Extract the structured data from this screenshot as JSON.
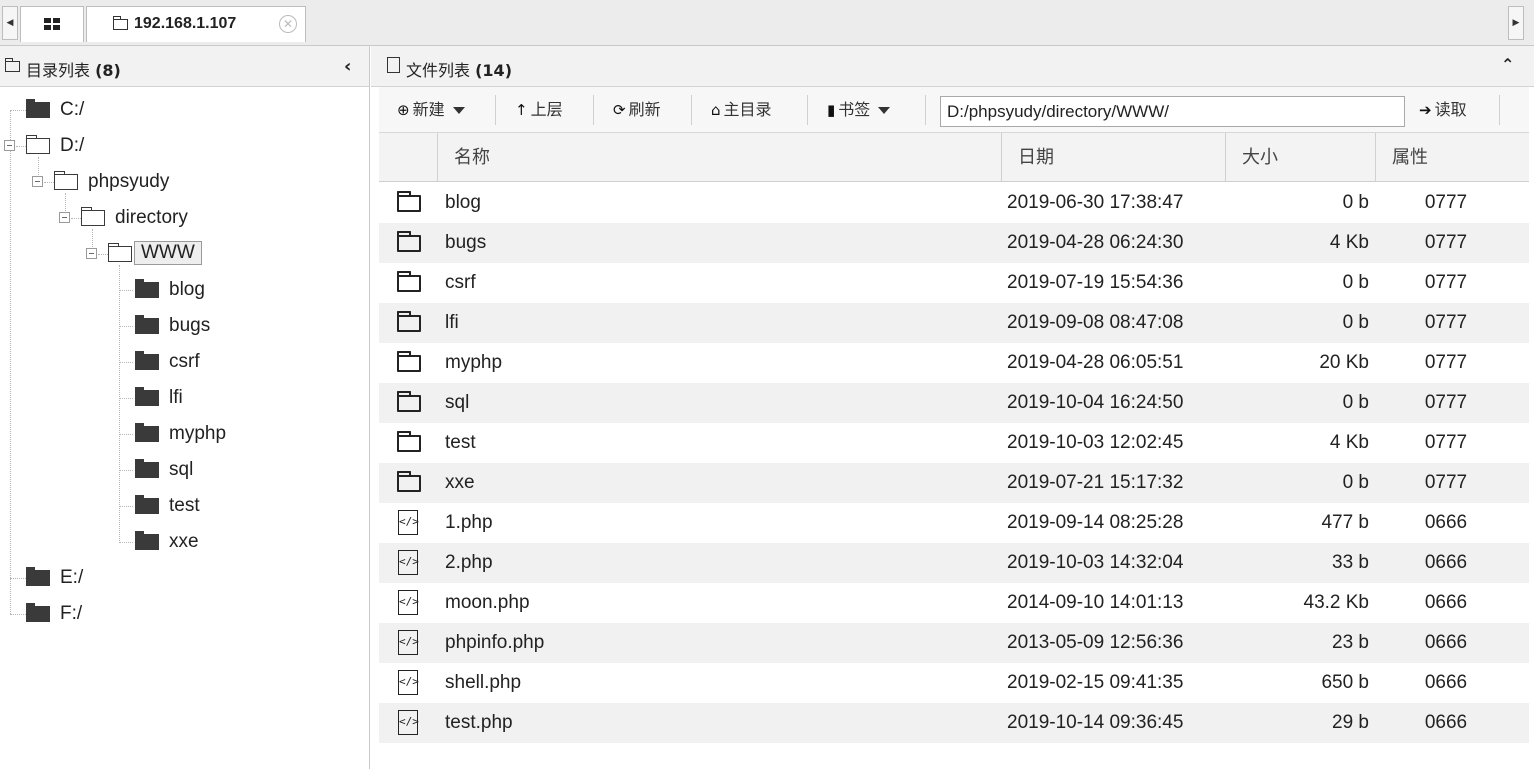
{
  "tabs": {
    "active_title": "192.168.1.107"
  },
  "left": {
    "title": "目录列表",
    "count": "(8)",
    "tree": {
      "c_drive": "C:/",
      "d_drive": "D:/",
      "phpsyudy": "phpsyudy",
      "directory": "directory",
      "www": "WWW",
      "children": [
        "blog",
        "bugs",
        "csrf",
        "lfi",
        "myphp",
        "sql",
        "test",
        "xxe"
      ],
      "e_drive": "E:/",
      "f_drive": "F:/"
    }
  },
  "right": {
    "title": "文件列表",
    "count": "(14)",
    "toolbar": {
      "new_label": "新建",
      "up_label": "上层",
      "refresh_label": "刷新",
      "home_label": "主目录",
      "bookmark_label": "书签",
      "path_value": "D:/phpsyudy/directory/WWW/",
      "read_label": "读取"
    },
    "columns": {
      "name": "名称",
      "date": "日期",
      "size": "大小",
      "attr": "属性"
    },
    "files": [
      {
        "type": "folder",
        "name": "blog",
        "date": "2019-06-30 17:38:47",
        "size": "0 b",
        "attr": "0777"
      },
      {
        "type": "folder",
        "name": "bugs",
        "date": "2019-04-28 06:24:30",
        "size": "4 Kb",
        "attr": "0777"
      },
      {
        "type": "folder",
        "name": "csrf",
        "date": "2019-07-19 15:54:36",
        "size": "0 b",
        "attr": "0777"
      },
      {
        "type": "folder",
        "name": "lfi",
        "date": "2019-09-08 08:47:08",
        "size": "0 b",
        "attr": "0777"
      },
      {
        "type": "folder",
        "name": "myphp",
        "date": "2019-04-28 06:05:51",
        "size": "20 Kb",
        "attr": "0777"
      },
      {
        "type": "folder",
        "name": "sql",
        "date": "2019-10-04 16:24:50",
        "size": "0 b",
        "attr": "0777"
      },
      {
        "type": "folder",
        "name": "test",
        "date": "2019-10-03 12:02:45",
        "size": "4 Kb",
        "attr": "0777"
      },
      {
        "type": "folder",
        "name": "xxe",
        "date": "2019-07-21 15:17:32",
        "size": "0 b",
        "attr": "0777"
      },
      {
        "type": "php",
        "name": "1.php",
        "date": "2019-09-14 08:25:28",
        "size": "477 b",
        "attr": "0666"
      },
      {
        "type": "php",
        "name": "2.php",
        "date": "2019-10-03 14:32:04",
        "size": "33 b",
        "attr": "0666"
      },
      {
        "type": "php",
        "name": "moon.php",
        "date": "2014-09-10 14:01:13",
        "size": "43.2 Kb",
        "attr": "0666"
      },
      {
        "type": "php",
        "name": "phpinfo.php",
        "date": "2013-05-09 12:56:36",
        "size": "23 b",
        "attr": "0666"
      },
      {
        "type": "php",
        "name": "shell.php",
        "date": "2019-02-15 09:41:35",
        "size": "650 b",
        "attr": "0666"
      },
      {
        "type": "php",
        "name": "test.php",
        "date": "2019-10-14 09:36:45",
        "size": "29 b",
        "attr": "0666"
      }
    ]
  }
}
